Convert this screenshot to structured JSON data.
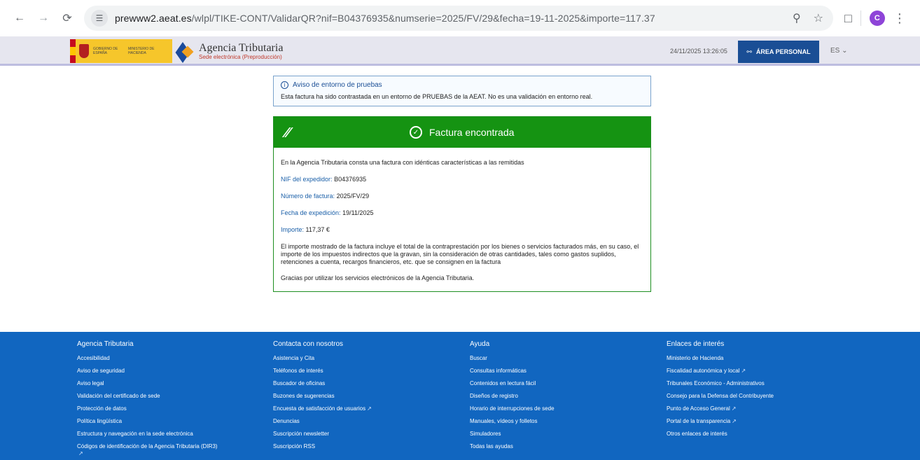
{
  "browser": {
    "url_scheme_host": "prewww2.aeat.es",
    "url_path": "/wlpl/TIKE-CONT/ValidarQR?nif=B04376935&numserie=2025/FV/29&fecha=19-11-2025&importe=117.37",
    "profile_initial": "C"
  },
  "header": {
    "gov_text_1": "GOBIERNO DE ESPAÑA",
    "gov_text_2": "MINISTERIO DE HACIENDA",
    "aeat_title": "Agencia Tributaria",
    "aeat_subtitle": "Sede electrónica (Preproducción)",
    "datetime": "24/11/2025 13:26:05",
    "area_personal": "ÁREA PERSONAL",
    "language": "ES"
  },
  "notice": {
    "title": "Aviso de entorno de pruebas",
    "text": "Esta factura ha sido contrastada en un entorno de PRUEBAS de la AEAT. No es una validación en entorno real."
  },
  "result": {
    "title": "Factura encontrada",
    "intro": "En la Agencia Tributaria consta una factura con idénticas características a las remitidas",
    "nif_label": "NIF del expedidor:",
    "nif_value": "B04376935",
    "numero_label": "Número de factura:",
    "numero_value": "2025/FV/29",
    "fecha_label": "Fecha de expedición:",
    "fecha_value": "19/11/2025",
    "importe_label": "Importe:",
    "importe_value": "117,37 €",
    "disclaimer": "El importe mostrado de la factura incluye el total de la contraprestación por los bienes o servicios facturados más, en su caso, el importe de los impuestos indirectos que la gravan, sin la consideración de otras cantidades, tales como gastos suplidos, retenciones a cuenta, recargos financieros, etc. que se consignen en la factura",
    "thanks": "Gracias por utilizar los servicios electrónicos de la Agencia Tributaria."
  },
  "footer": {
    "columns": [
      {
        "heading": "Agencia Tributaria",
        "links": [
          "Accesibilidad",
          "Aviso de seguridad",
          "Aviso legal",
          "Validación del certificado de sede",
          "Protección de datos",
          "Política lingüística",
          "Estructura y navegación en la sede electrónica",
          "Códigos de identificación de la Agencia Tributaria (DIR3)"
        ]
      },
      {
        "heading": "Contacta con nosotros",
        "links": [
          "Asistencia y Cita",
          "Teléfonos de interés",
          "Buscador de oficinas",
          "Buzones de sugerencias",
          "Encuesta de satisfacción de usuarios",
          "Denuncias",
          "Suscripción newsletter",
          "Suscripción RSS"
        ]
      },
      {
        "heading": "Ayuda",
        "links": [
          "Buscar",
          "Consultas informáticas",
          "Contenidos en lectura fácil",
          "Diseños de registro",
          "Horario de interrupciones de sede",
          "Manuales, vídeos y folletos",
          "Simuladores",
          "Todas las ayudas"
        ]
      },
      {
        "heading": "Enlaces de interés",
        "links": [
          "Ministerio de Hacienda",
          "Fiscalidad autonómica y local",
          "Tribunales Económico - Administrativos",
          "Consejo para la Defensa del Contribuyente",
          "Punto de Acceso General",
          "Portal de la transparencia",
          "Otros enlaces de interés"
        ]
      }
    ]
  }
}
